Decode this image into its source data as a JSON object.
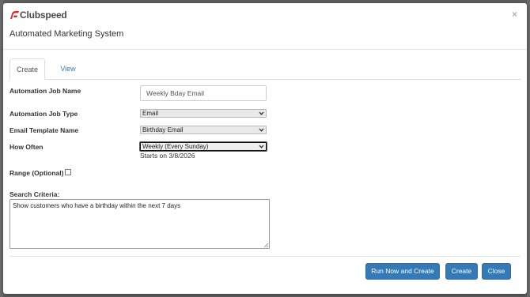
{
  "brand": {
    "name": "Clubspeed",
    "accent": "#d9252b"
  },
  "modal": {
    "title": "Automated Marketing System",
    "close_glyph": "×"
  },
  "tabs": [
    {
      "label": "Create",
      "active": true
    },
    {
      "label": "View",
      "active": false
    }
  ],
  "form": {
    "job_name": {
      "label": "Automation Job Name",
      "value": "Weekly Bday Email"
    },
    "job_type": {
      "label": "Automation Job Type",
      "value": "Email"
    },
    "template": {
      "label": "Email Template Name",
      "value": "Birthday Email"
    },
    "how_often": {
      "label": "How Often",
      "value": "Weekly (Every Sunday)",
      "note": "Starts on 3/8/2026"
    },
    "range": {
      "label": "Range (Optional)",
      "checked": false
    },
    "criteria": {
      "label": "Search Criteria:",
      "value": "Show customers who have a birthday within the next 7 days"
    }
  },
  "buttons": {
    "run_create": "Run Now and Create",
    "create": "Create",
    "close": "Close"
  },
  "colors": {
    "primary": "#337ab7",
    "link": "#337ab7"
  }
}
